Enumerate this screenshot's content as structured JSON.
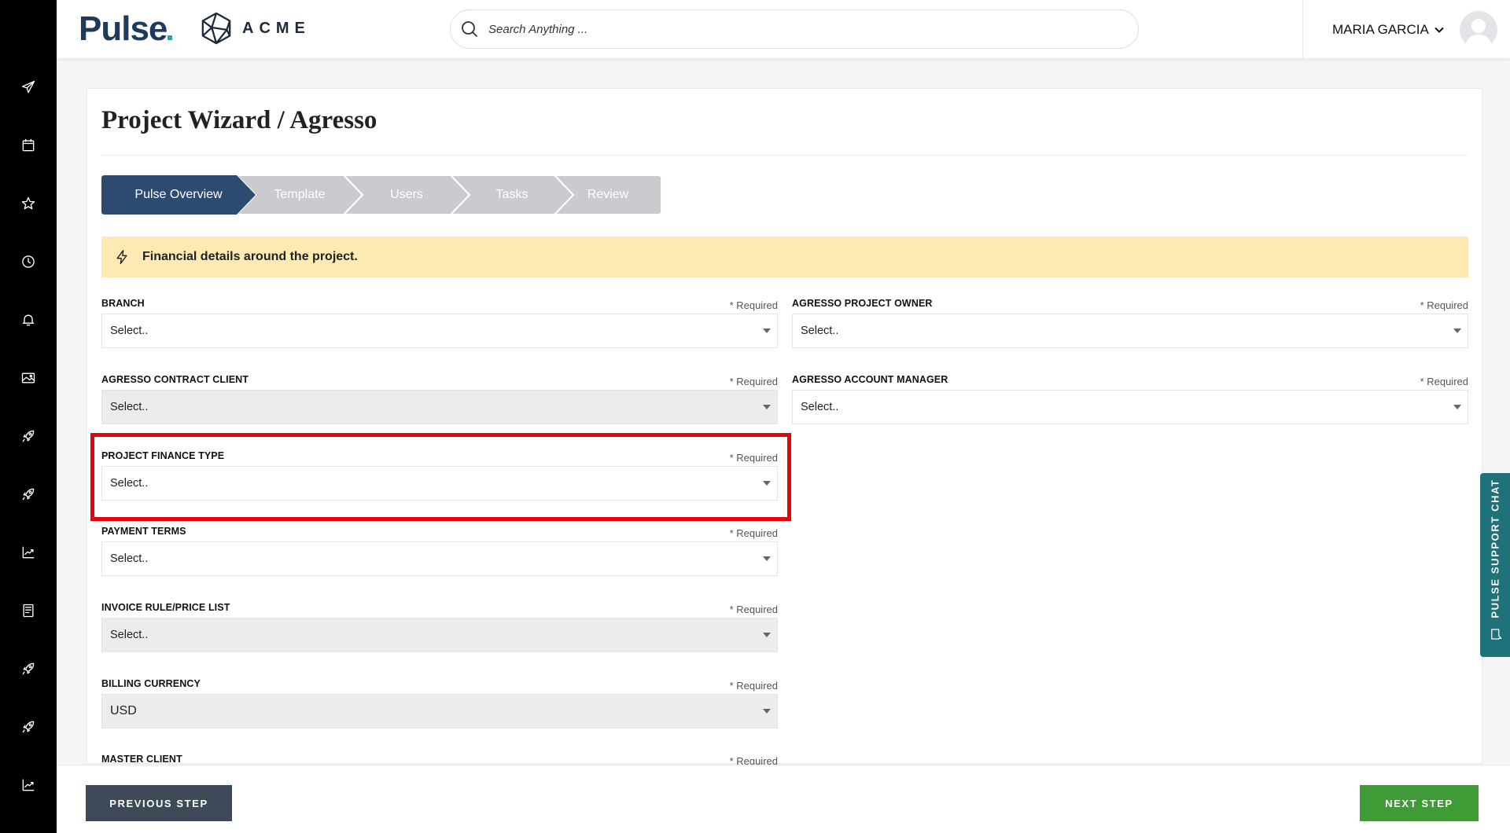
{
  "header": {
    "logo_text": "Pulse",
    "brand_text": "ACME",
    "search_placeholder": "Search Anything ...",
    "user_name": "MARIA GARCIA"
  },
  "sidebar": {
    "icons": [
      "paper-plane-icon",
      "calendar-icon",
      "star-icon",
      "clock-icon",
      "bell-icon",
      "image-icon",
      "rocket-icon",
      "rocket-icon",
      "chart-icon",
      "notebook-icon",
      "rocket-icon",
      "rocket-icon",
      "chart-icon"
    ]
  },
  "page": {
    "title": "Project Wizard / Agresso"
  },
  "wizard": {
    "steps": [
      {
        "label": "Pulse Overview",
        "active": true
      },
      {
        "label": "Template",
        "active": false
      },
      {
        "label": "Users",
        "active": false
      },
      {
        "label": "Tasks",
        "active": false
      },
      {
        "label": "Review",
        "active": false
      }
    ]
  },
  "banner": {
    "text": "Financial details around the project."
  },
  "fields": {
    "required_text": "* Required",
    "branch": {
      "label": "BRANCH",
      "value": "Select.."
    },
    "agresso_project_owner": {
      "label": "AGRESSO PROJECT OWNER",
      "value": "Select.."
    },
    "agresso_contract_client": {
      "label": "AGRESSO CONTRACT CLIENT",
      "value": "Select.."
    },
    "agresso_account_manager": {
      "label": "AGRESSO ACCOUNT MANAGER",
      "value": "Select.."
    },
    "project_finance_type": {
      "label": "PROJECT FINANCE TYPE",
      "value": "Select.."
    },
    "payment_terms": {
      "label": "PAYMENT TERMS",
      "value": "Select.."
    },
    "invoice_rule": {
      "label": "INVOICE RULE/PRICE LIST",
      "value": "Select.."
    },
    "billing_currency": {
      "label": "BILLING CURRENCY",
      "value": "USD"
    },
    "master_client": {
      "label": "MASTER CLIENT"
    }
  },
  "footer": {
    "prev_label": "PREVIOUS STEP",
    "next_label": "NEXT STEP"
  },
  "support": {
    "label": "PULSE SUPPORT CHAT"
  },
  "colors": {
    "step_active": "#2d4a70",
    "step_inactive": "#c9cbcf",
    "banner_bg": "#fde9b3",
    "highlight": "#e3050b",
    "next_button": "#3f9b35",
    "prev_button": "#3f4a59",
    "support_tab": "#20727a"
  }
}
